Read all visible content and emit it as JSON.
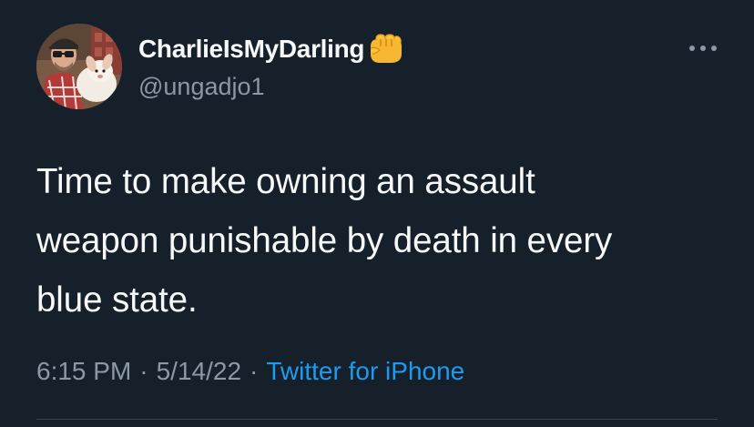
{
  "author": {
    "display_name": "CharlieIsMyDarling",
    "handle": "@ungadjo1",
    "badge_icon": "oncoming-fist-icon"
  },
  "tweet": {
    "text": "Time to make owning an assault\nweapon punishable by death in every\nblue state."
  },
  "meta": {
    "time": "6:15 PM",
    "date": "5/14/22",
    "separator": "·",
    "source": "Twitter for iPhone"
  },
  "more_icon": "ellipsis-icon",
  "colors": {
    "background": "#15202b",
    "text_primary": "#f7f9f9",
    "text_secondary": "#8b98a5",
    "link": "#1d9bf0",
    "divider": "#38444d"
  }
}
